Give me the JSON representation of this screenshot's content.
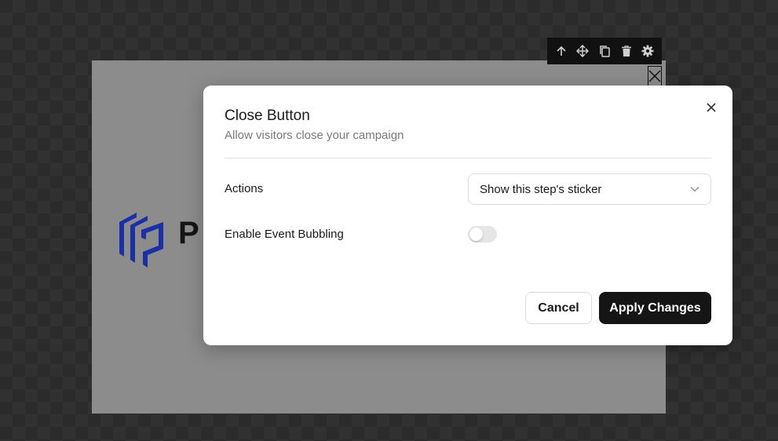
{
  "canvas": {
    "logo_text": "P"
  },
  "toolbar": {
    "icons": [
      "arrow-up-icon",
      "move-icon",
      "copy-icon",
      "trash-icon",
      "gear-icon"
    ]
  },
  "modal": {
    "title": "Close Button",
    "subtitle": "Allow visitors close your campaign",
    "actions_label": "Actions",
    "actions_value": "Show this step's sticker",
    "bubbling_label": "Enable Event Bubbling",
    "bubbling_enabled": false,
    "cancel_label": "Cancel",
    "apply_label": "Apply Changes"
  },
  "colors": {
    "logo_blue": "#1a2fa8",
    "primary_button": "#151515"
  }
}
